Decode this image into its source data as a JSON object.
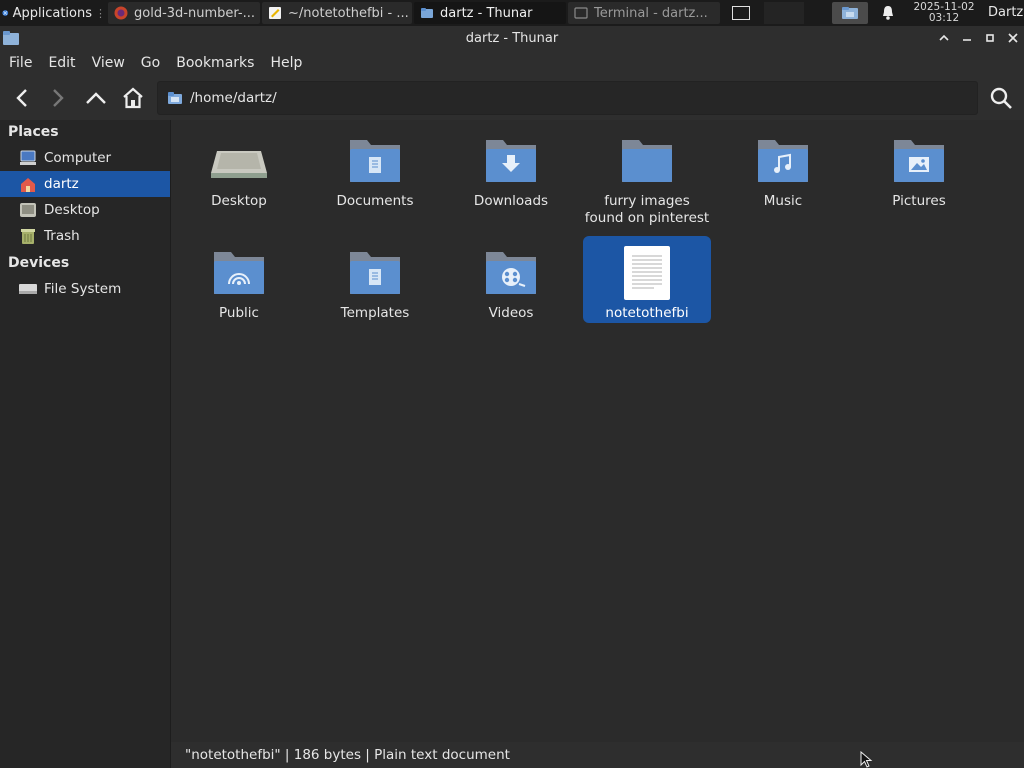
{
  "panel": {
    "applications_label": "Applications",
    "tasks": [
      {
        "label": "gold-3d-number-..."
      },
      {
        "label": "~/notetothefbi - ..."
      },
      {
        "label": "dartz - Thunar"
      },
      {
        "label": "Terminal - dartz..."
      }
    ],
    "clock_date": "2025-11-02",
    "clock_time": "03:12",
    "user": "Dartz"
  },
  "window": {
    "title": "dartz - Thunar"
  },
  "menubar": {
    "items": [
      "File",
      "Edit",
      "View",
      "Go",
      "Bookmarks",
      "Help"
    ]
  },
  "toolbar": {
    "path": "/home/dartz/"
  },
  "sidebar": {
    "places_heading": "Places",
    "places": [
      {
        "label": "Computer",
        "icon": "computer-icon"
      },
      {
        "label": "dartz",
        "icon": "home-icon",
        "selected": true
      },
      {
        "label": "Desktop",
        "icon": "desktop-icon"
      },
      {
        "label": "Trash",
        "icon": "trash-icon"
      }
    ],
    "devices_heading": "Devices",
    "devices": [
      {
        "label": "File System",
        "icon": "drive-icon"
      }
    ]
  },
  "files": [
    {
      "name": "Desktop",
      "type": "desktop-folder"
    },
    {
      "name": "Documents",
      "type": "documents-folder"
    },
    {
      "name": "Downloads",
      "type": "downloads-folder"
    },
    {
      "name": "furry images found on pinterest",
      "type": "folder"
    },
    {
      "name": "Music",
      "type": "music-folder"
    },
    {
      "name": "Pictures",
      "type": "pictures-folder"
    },
    {
      "name": "Public",
      "type": "public-folder"
    },
    {
      "name": "Templates",
      "type": "templates-folder"
    },
    {
      "name": "Videos",
      "type": "videos-folder"
    },
    {
      "name": "notetothefbi",
      "type": "text-file",
      "selected": true
    }
  ],
  "status": {
    "text": "\"notetothefbi\"  |  186 bytes  |  Plain text document"
  },
  "colors": {
    "selection": "#1c56a5",
    "folder": "#5b8fcf",
    "background": "#2b2b2b"
  }
}
